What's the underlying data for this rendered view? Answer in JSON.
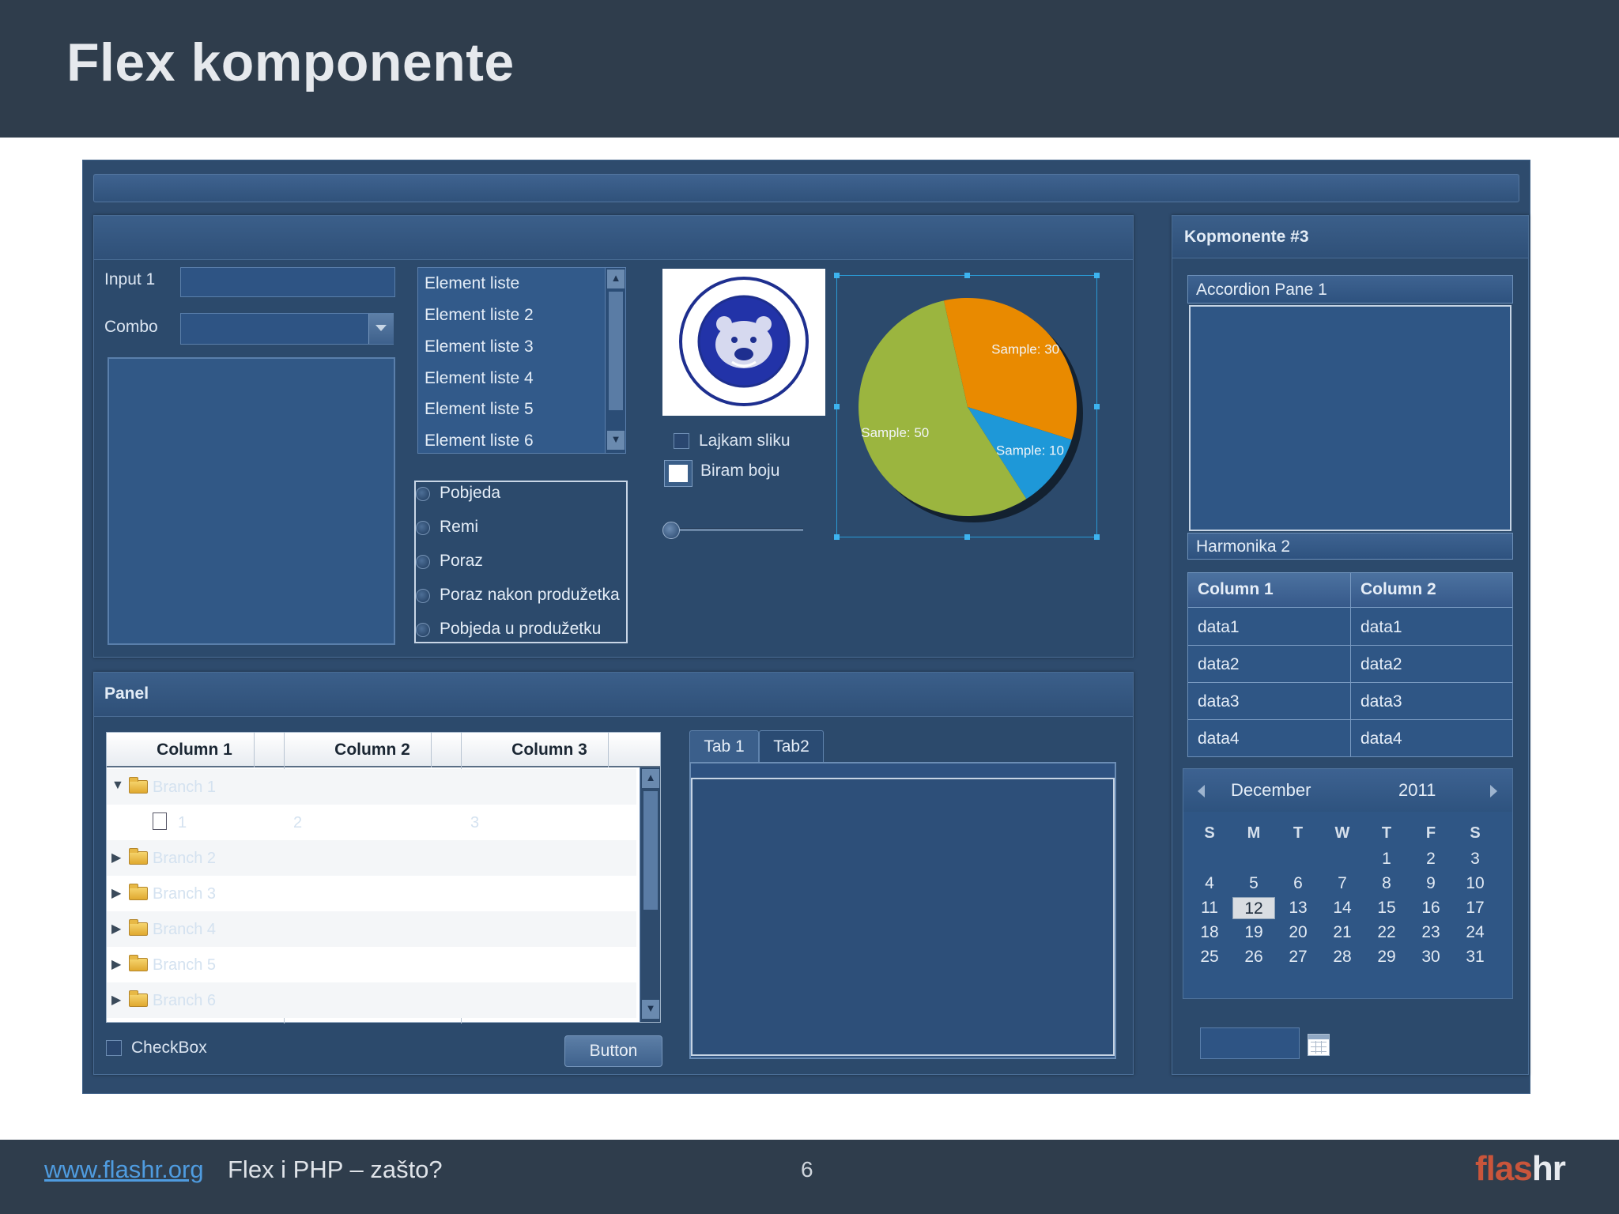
{
  "slide": {
    "title": "Flex komponente",
    "footer_link": "www.flashr.org",
    "footer_text": "Flex i PHP – zašto?",
    "page_number": "6",
    "logo_part1": "flas",
    "logo_part2": "hr"
  },
  "form": {
    "input1_label": "Input 1",
    "combo_label": "Combo"
  },
  "list": {
    "items": [
      "Element liste",
      "Element liste 2",
      "Element liste 3",
      "Element liste 4",
      "Element liste 5",
      "Element liste 6"
    ]
  },
  "radios": {
    "items": [
      "Pobjeda",
      "Remi",
      "Poraz",
      "Poraz nakon produžetka",
      "Pobjeda u produžetku"
    ]
  },
  "image_controls": {
    "checkbox_label": "Lajkam sliku",
    "colorpicker_label": "Biram boju",
    "slider_value": 0
  },
  "pie": {
    "labels": [
      "Sample: 30",
      "Sample: 10",
      "Sample: 50"
    ]
  },
  "chart_data": {
    "type": "pie",
    "categories": [
      "Sample",
      "Sample",
      "Sample"
    ],
    "values": [
      30,
      10,
      50
    ],
    "colors": [
      "#e98a00",
      "#1e98d8",
      "#9bb53f"
    ]
  },
  "panel": {
    "title": "Panel",
    "tree": {
      "columns": [
        "Column 1",
        "Column 2",
        "Column 3"
      ],
      "rows": [
        {
          "name": "Branch 1",
          "c2": "",
          "c3": ""
        },
        {
          "name": "1",
          "c2": "2",
          "c3": "3"
        },
        {
          "name": "Branch 2",
          "c2": "",
          "c3": ""
        },
        {
          "name": "Branch 3",
          "c2": "",
          "c3": ""
        },
        {
          "name": "Branch 4",
          "c2": "",
          "c3": ""
        },
        {
          "name": "Branch 5",
          "c2": "",
          "c3": ""
        },
        {
          "name": "Branch 6",
          "c2": "",
          "c3": ""
        }
      ]
    },
    "checkbox_label": "CheckBox",
    "button_label": "Button",
    "tabs": [
      "Tab 1",
      "Tab2"
    ]
  },
  "right_panel": {
    "title": "Kopmonente #3",
    "accordion": [
      "Accordion Pane 1",
      "Harmonika 2"
    ],
    "datagrid": {
      "columns": [
        "Column 1",
        "Column 2"
      ],
      "rows": [
        [
          "data1",
          "data1"
        ],
        [
          "data2",
          "data2"
        ],
        [
          "data3",
          "data3"
        ],
        [
          "data4",
          "data4"
        ]
      ]
    },
    "calendar": {
      "month": "December",
      "year": "2011",
      "day_names": [
        "S",
        "M",
        "T",
        "W",
        "T",
        "F",
        "S"
      ],
      "weeks": [
        [
          "",
          "",
          "",
          "",
          "1",
          "2",
          "3"
        ],
        [
          "4",
          "5",
          "6",
          "7",
          "8",
          "9",
          "10"
        ],
        [
          "11",
          "12",
          "13",
          "14",
          "15",
          "16",
          "17"
        ],
        [
          "18",
          "19",
          "20",
          "21",
          "22",
          "23",
          "24"
        ],
        [
          "25",
          "26",
          "27",
          "28",
          "29",
          "30",
          "31"
        ]
      ],
      "selected": "12"
    }
  }
}
